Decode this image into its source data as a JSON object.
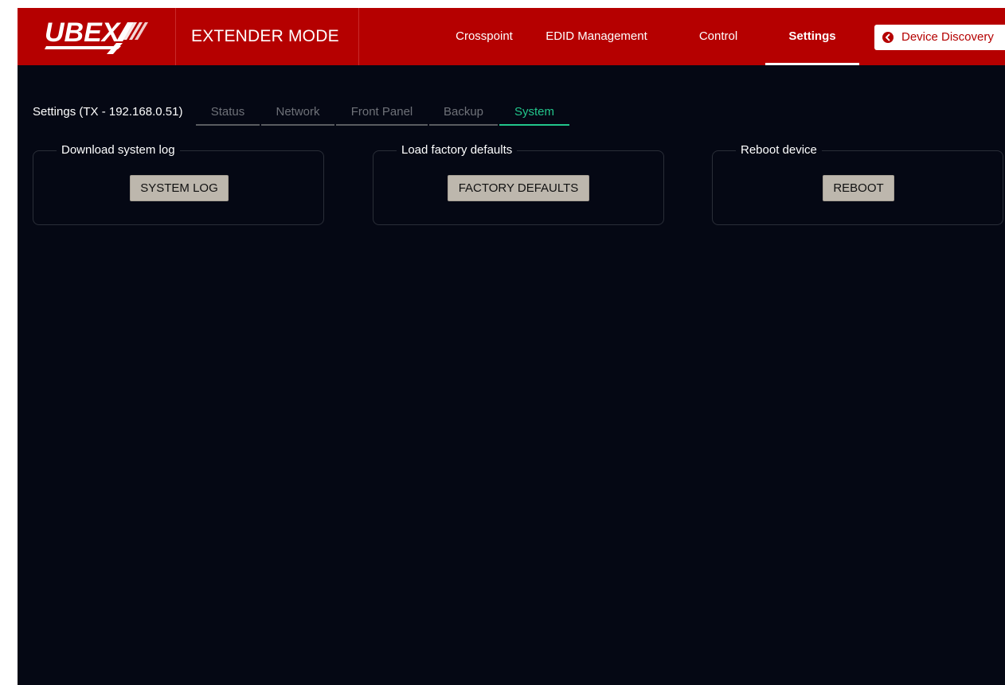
{
  "header": {
    "logo_text": "UBEX",
    "mode_title": "EXTENDER MODE",
    "nav": [
      {
        "label": "Crosspoint",
        "active": false
      },
      {
        "label": "EDID Management",
        "active": false
      },
      {
        "label": "Control",
        "active": false
      },
      {
        "label": "Settings",
        "active": true
      }
    ],
    "discovery_button": {
      "label": "Device Discovery",
      "icon": "chevron-left-circle-icon"
    }
  },
  "settings": {
    "title": "Settings (TX - 192.168.0.51)",
    "tabs": [
      {
        "label": "Status",
        "active": false
      },
      {
        "label": "Network",
        "active": false
      },
      {
        "label": "Front Panel",
        "active": false
      },
      {
        "label": "Backup",
        "active": false
      },
      {
        "label": "System",
        "active": true
      }
    ],
    "panels": [
      {
        "legend": "Download system log",
        "button": "SYSTEM LOG"
      },
      {
        "legend": "Load factory defaults",
        "button": "FACTORY DEFAULTS"
      },
      {
        "legend": "Reboot device",
        "button": "REBOOT"
      }
    ]
  },
  "colors": {
    "header_bg": "#b50000",
    "page_bg": "#050814",
    "active_tab": "#22c58b",
    "button_bg": "#bdb7ad"
  }
}
